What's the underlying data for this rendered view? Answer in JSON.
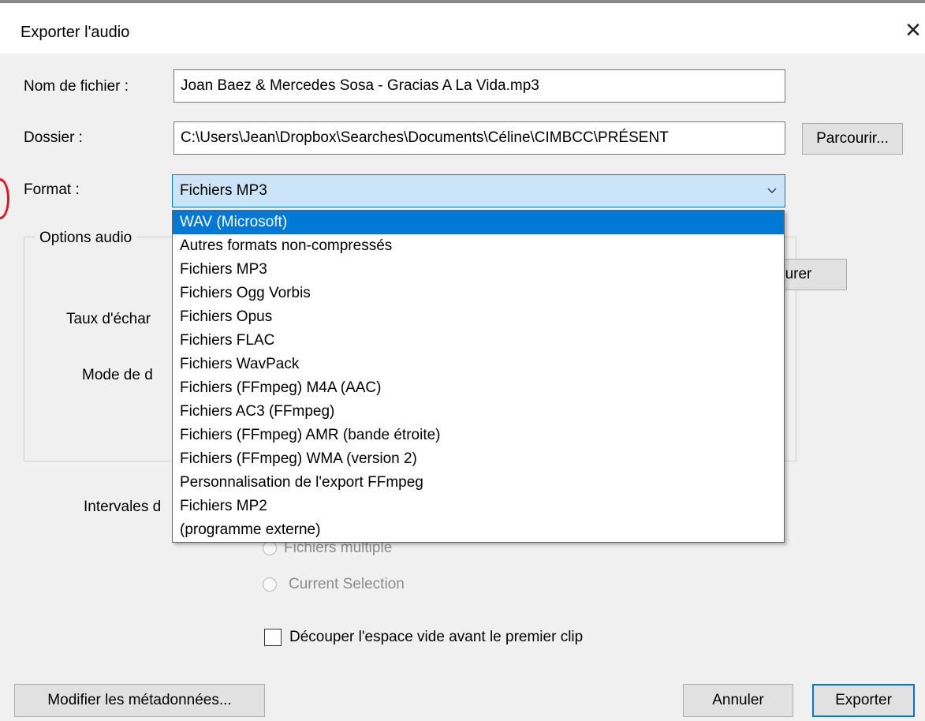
{
  "dialog": {
    "title": "Exporter l'audio",
    "close": "✕"
  },
  "filename": {
    "label": "Nom de fichier :",
    "value": "Joan Baez & Mercedes Sosa - Gracias A La Vida.mp3"
  },
  "folder": {
    "label": "Dossier :",
    "value": "C:\\Users\\Jean\\Dropbox\\Searches\\Documents\\Céline\\CIMBCC\\PRÉSENT",
    "browse": "Parcourir..."
  },
  "format": {
    "label": "Format :",
    "selected": "Fichiers MP3",
    "options": [
      "WAV (Microsoft)",
      "Autres formats non-compressés",
      "Fichiers MP3",
      "Fichiers Ogg Vorbis",
      "Fichiers Opus",
      "Fichiers FLAC",
      "Fichiers WavPack",
      "Fichiers (FFmpeg) M4A (AAC)",
      "Fichiers AC3 (FFmpeg)",
      "Fichiers (FFmpeg) AMR (bande étroite)",
      "Fichiers (FFmpeg) WMA (version 2)",
      "Personnalisation de l'export FFmpeg",
      "Fichiers MP2",
      "(programme externe)"
    ],
    "highlighted_option": "WAV (Microsoft)"
  },
  "audio_options": {
    "title": "Options audio",
    "configure_partial": "gurer",
    "sample_rate_partial": "Taux d'échar",
    "mode_partial": "Mode de d"
  },
  "ranges": {
    "label_partial": "Intervales d",
    "multiple_partial": "Fichiers multiple",
    "current_selection": "Current Selection"
  },
  "trim_checkbox": {
    "label": "Découper l'espace vide avant le premier clip",
    "checked": false
  },
  "footer": {
    "metadata": "Modifier les métadonnées...",
    "cancel": "Annuler",
    "export": "Exporter"
  },
  "colors": {
    "accent": "#0078d7",
    "selection_bg": "#cce4f7",
    "marker": "#e8141c"
  }
}
